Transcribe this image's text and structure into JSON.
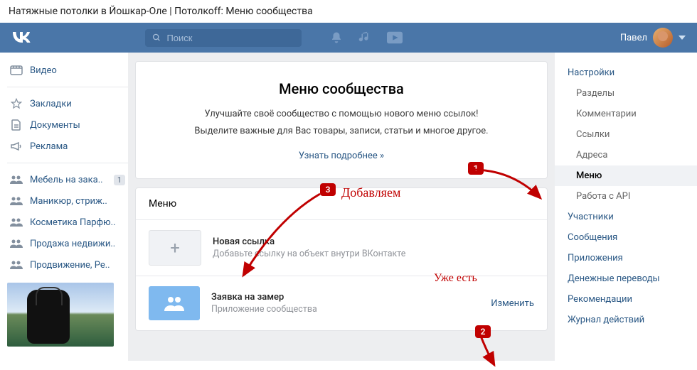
{
  "browser_title": "Натяжные потолки в Йошкар-Оле | Потолкоff: Меню сообщества",
  "header": {
    "search_placeholder": "Поиск",
    "user_name": "Павел"
  },
  "left_nav": {
    "items": [
      {
        "icon": "video",
        "label": "Видео"
      },
      {
        "icon": "bookmark",
        "label": "Закладки"
      },
      {
        "icon": "doc",
        "label": "Документы"
      },
      {
        "icon": "ads",
        "label": "Реклама"
      }
    ],
    "groups": [
      {
        "label": "Мебель на зака..",
        "badge": "1"
      },
      {
        "label": "Маникюр, стриж.."
      },
      {
        "label": "Косметика Парфю.."
      },
      {
        "label": "Продажа недвижи.."
      },
      {
        "label": "Продвижение, Ре.."
      }
    ]
  },
  "intro": {
    "title": "Меню сообщества",
    "line1": "Улучшайте своё сообщество с помощью нового меню ссылок!",
    "line2": "Выделите важные для Вас товары, записи, статьи и многое другое.",
    "learn_more": "Узнать подробнее »"
  },
  "menu_panel": {
    "header": "Меню",
    "rows": [
      {
        "kind": "add",
        "title": "Новая ссылка",
        "sub": "Добавьте ссылку на объект внутри ВКонтакте"
      },
      {
        "kind": "app",
        "title": "Заявка на замер",
        "sub": "Приложение сообщества",
        "action": "Изменить"
      }
    ]
  },
  "right_nav": {
    "items": [
      {
        "label": "Настройки",
        "sub": false
      },
      {
        "label": "Разделы",
        "sub": true
      },
      {
        "label": "Комментарии",
        "sub": true
      },
      {
        "label": "Ссылки",
        "sub": true
      },
      {
        "label": "Адреса",
        "sub": true
      },
      {
        "label": "Меню",
        "sub": true,
        "active": true
      },
      {
        "label": "Работа с API",
        "sub": true
      },
      {
        "label": "Участники",
        "sub": false
      },
      {
        "label": "Сообщения",
        "sub": false
      },
      {
        "label": "Приложения",
        "sub": false
      },
      {
        "label": "Денежные переводы",
        "sub": false
      },
      {
        "label": "Рекомендации",
        "sub": false
      },
      {
        "label": "Журнал действий",
        "sub": false
      }
    ]
  },
  "annotations": {
    "n1": "1",
    "n2": "2",
    "n3": "3",
    "add_text": "Добавляем",
    "already_text": "Уже есть"
  }
}
